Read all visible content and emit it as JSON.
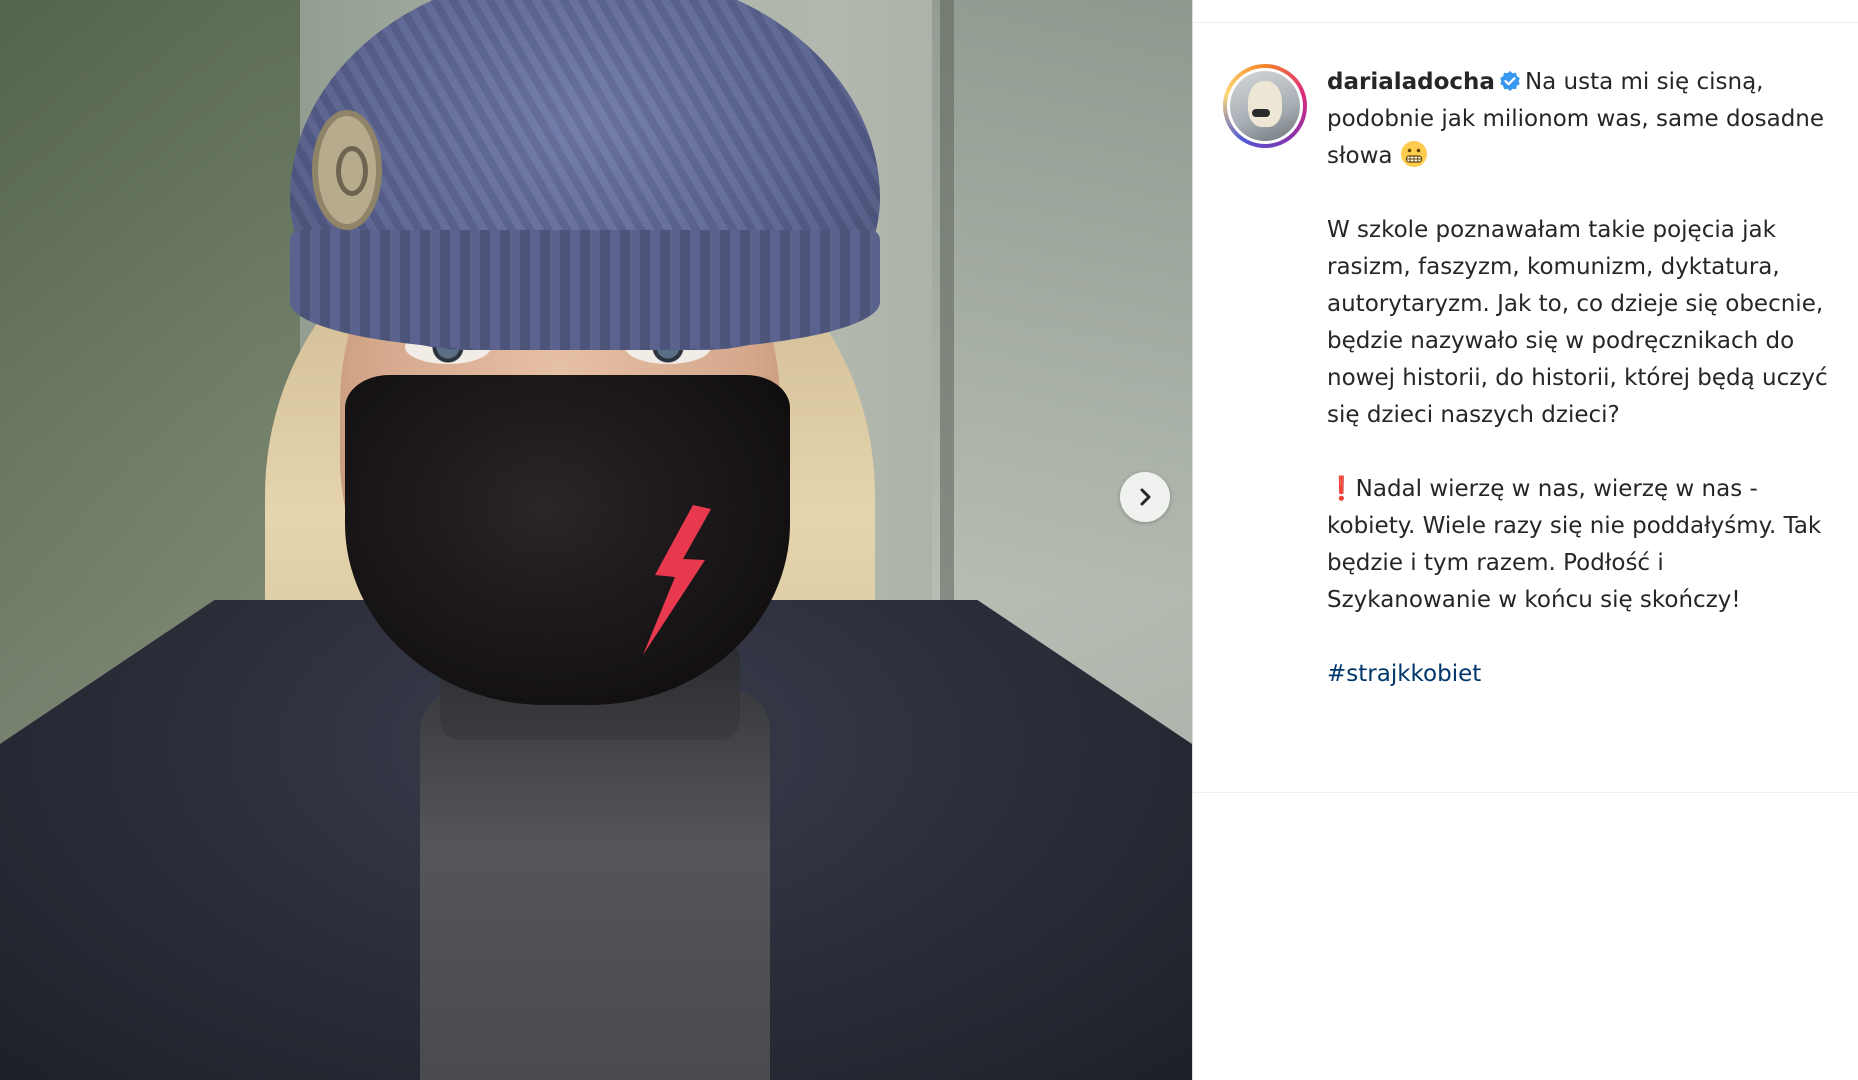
{
  "photo": {
    "next_icon": "chevron-right-icon"
  },
  "caption": {
    "username": "darialadocha",
    "verified_icon": "verified-badge-icon",
    "lead_text": "Na usta mi się cisną, podobnie jak milionom was, same dosadne słowa",
    "lead_emoji": "grimacing-face-emoji",
    "paragraph_2": "W szkole poznawałam takie pojęcia jak rasizm, faszyzm, komunizm, dyktatura, autorytaryzm. Jak to, co dzieje się obecnie, będzie nazywało się w podręcznikach do nowej historii, do historii, której będą uczyć się dzieci naszych dzieci?",
    "paragraph_3_mark": "❗",
    "paragraph_3": "Nadal wierzę w nas, wierzę w nas - kobiety. Wiele razy się nie poddałyśmy. Tak będzie i tym razem. Podłość i Szykanowanie w końcu się skończy!",
    "hashtag": "#strajkkobiet"
  },
  "colors": {
    "link": "#00376b",
    "verified": "#3897f0",
    "text": "#262626",
    "bolt": "#e8394f"
  }
}
